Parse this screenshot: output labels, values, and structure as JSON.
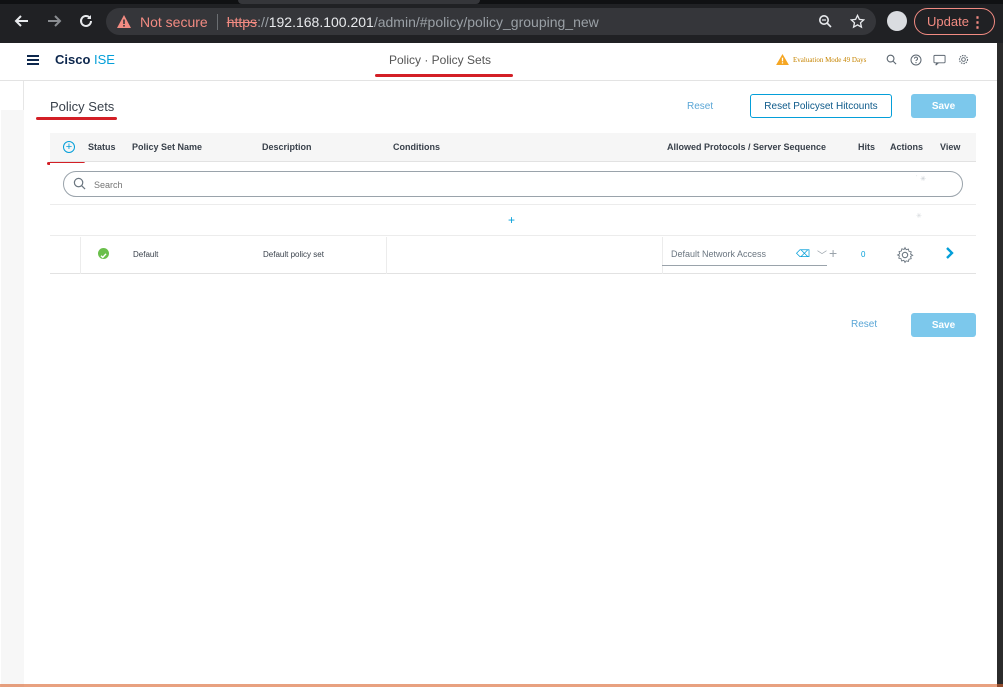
{
  "browser": {
    "not_secure_label": "Not secure",
    "url_scheme": "https",
    "url_sep": "://",
    "url_host": "192.168.100.201",
    "url_path": "/admin/#policy/policy_grouping_new",
    "update_label": "Update"
  },
  "header": {
    "brand_bold": "Cisco",
    "brand_rest": " ISE",
    "crumb": "Policy · Policy Sets",
    "evaluation": "Evaluation Mode 49 Days"
  },
  "page": {
    "title": "Policy Sets",
    "reset_label": "Reset",
    "reset_hitcounts_label": "Reset Policyset Hitcounts",
    "save_label": "Save"
  },
  "table": {
    "columns": {
      "status": "Status",
      "name": "Policy Set Name",
      "description": "Description",
      "conditions": "Conditions",
      "protocols": "Allowed Protocols / Server Sequence",
      "hits": "Hits",
      "actions": "Actions",
      "view": "View"
    },
    "search_placeholder": "Search",
    "rows": [
      {
        "status": "enabled",
        "name": "Default",
        "description": "Default policy set",
        "conditions": "",
        "protocol": "Default Network Access",
        "hits": "0"
      }
    ]
  },
  "footer": {
    "reset_label": "Reset",
    "save_label": "Save"
  },
  "colors": {
    "accent": "#049fd9",
    "brand_dark": "#0d274d",
    "status_green": "#6abf4b",
    "warning": "#f5a623",
    "highlight_red": "#d31f26",
    "save_button": "#7cc8ec"
  },
  "icons": [
    "back-icon",
    "forward-icon",
    "reload-icon",
    "warning-icon",
    "zoom-icon",
    "star-icon",
    "hamburger-icon",
    "search-icon",
    "help-icon",
    "feedback-icon",
    "gear-icon",
    "add-icon",
    "chevron-right-icon"
  ]
}
